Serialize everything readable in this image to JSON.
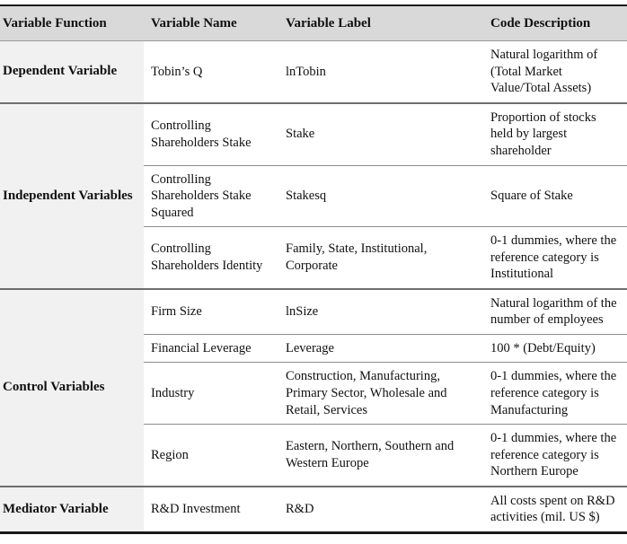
{
  "table": {
    "columns": [
      {
        "key": "function",
        "label": "Variable Function"
      },
      {
        "key": "name",
        "label": "Variable Name"
      },
      {
        "key": "label",
        "label": "Variable Label"
      },
      {
        "key": "description",
        "label": "Code Description"
      }
    ],
    "header_background": "#d9d9d9",
    "group_column_background": "#f1f1f1",
    "groups": [
      {
        "function": "Dependent Variable",
        "rows": [
          {
            "name": "Tobin’s Q",
            "label": "lnTobin",
            "description": "Natural logarithm of (Total Market Value/Total Assets)"
          }
        ]
      },
      {
        "function": "Independent Variables",
        "rows": [
          {
            "name": "Controlling Shareholders Stake",
            "label": "Stake",
            "description": "Proportion of stocks held by largest shareholder"
          },
          {
            "name": "Controlling Shareholders Stake Squared",
            "label": "Stakesq",
            "description": "Square of Stake"
          },
          {
            "name": "Controlling Shareholders Identity",
            "label": "Family, State, Institutional, Corporate",
            "description": "0-1 dummies, where the reference category is Institutional"
          }
        ]
      },
      {
        "function": "Control Variables",
        "rows": [
          {
            "name": "Firm Size",
            "label": "lnSize",
            "description": "Natural logarithm of the number of employees"
          },
          {
            "name": "Financial Leverage",
            "label": "Leverage",
            "description": "100 * (Debt/Equity)"
          },
          {
            "name": "Industry",
            "label": "Construction, Manufacturing, Primary Sector, Wholesale and Retail, Services",
            "description": "0-1 dummies, where the reference category is Manufacturing"
          },
          {
            "name": "Region",
            "label": "Eastern, Northern, Southern and Western Europe",
            "description": "0-1 dummies, where the reference category is Northern Europe"
          }
        ]
      },
      {
        "function": "Mediator Variable",
        "rows": [
          {
            "name": "R&D Investment",
            "label": "R&D",
            "description": "All costs spent on R&D activities (mil. US $)"
          }
        ]
      }
    ]
  }
}
